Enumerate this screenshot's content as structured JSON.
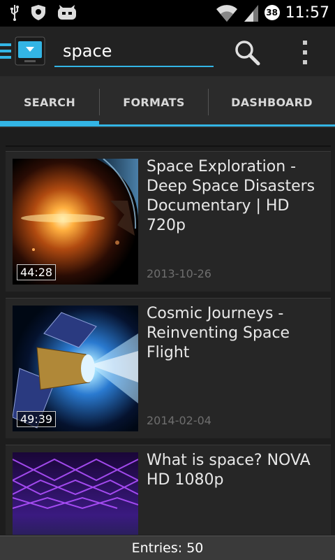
{
  "status_bar": {
    "time": "11:57",
    "notification_count": "38",
    "icons": [
      "usb-icon",
      "shield-icon",
      "cyanogen-icon",
      "wifi-icon",
      "signal-icon"
    ]
  },
  "action_bar": {
    "search_value": "space",
    "icons": [
      "menu-icon",
      "app-icon",
      "search-icon",
      "overflow-menu-icon"
    ]
  },
  "tabs": [
    {
      "label": "SEARCH",
      "selected": true
    },
    {
      "label": "FORMATS",
      "selected": false
    },
    {
      "label": "DASHBOARD",
      "selected": false
    }
  ],
  "results": [
    {
      "title": "Space Exploration - Deep Space Disasters Documentary | HD 720p",
      "duration": "44:28",
      "date": "2013-10-26"
    },
    {
      "title": "Cosmic Journeys - Reinventing Space Flight",
      "duration": "49:39",
      "date": "2014-02-04"
    },
    {
      "title": "What is space? NOVA HD 1080p",
      "duration": "",
      "date": ""
    }
  ],
  "footer": {
    "entries_label": "Entries: 50"
  },
  "colors": {
    "accent": "#33b5e5",
    "background": "#1d1d1d",
    "card": "#262626"
  }
}
